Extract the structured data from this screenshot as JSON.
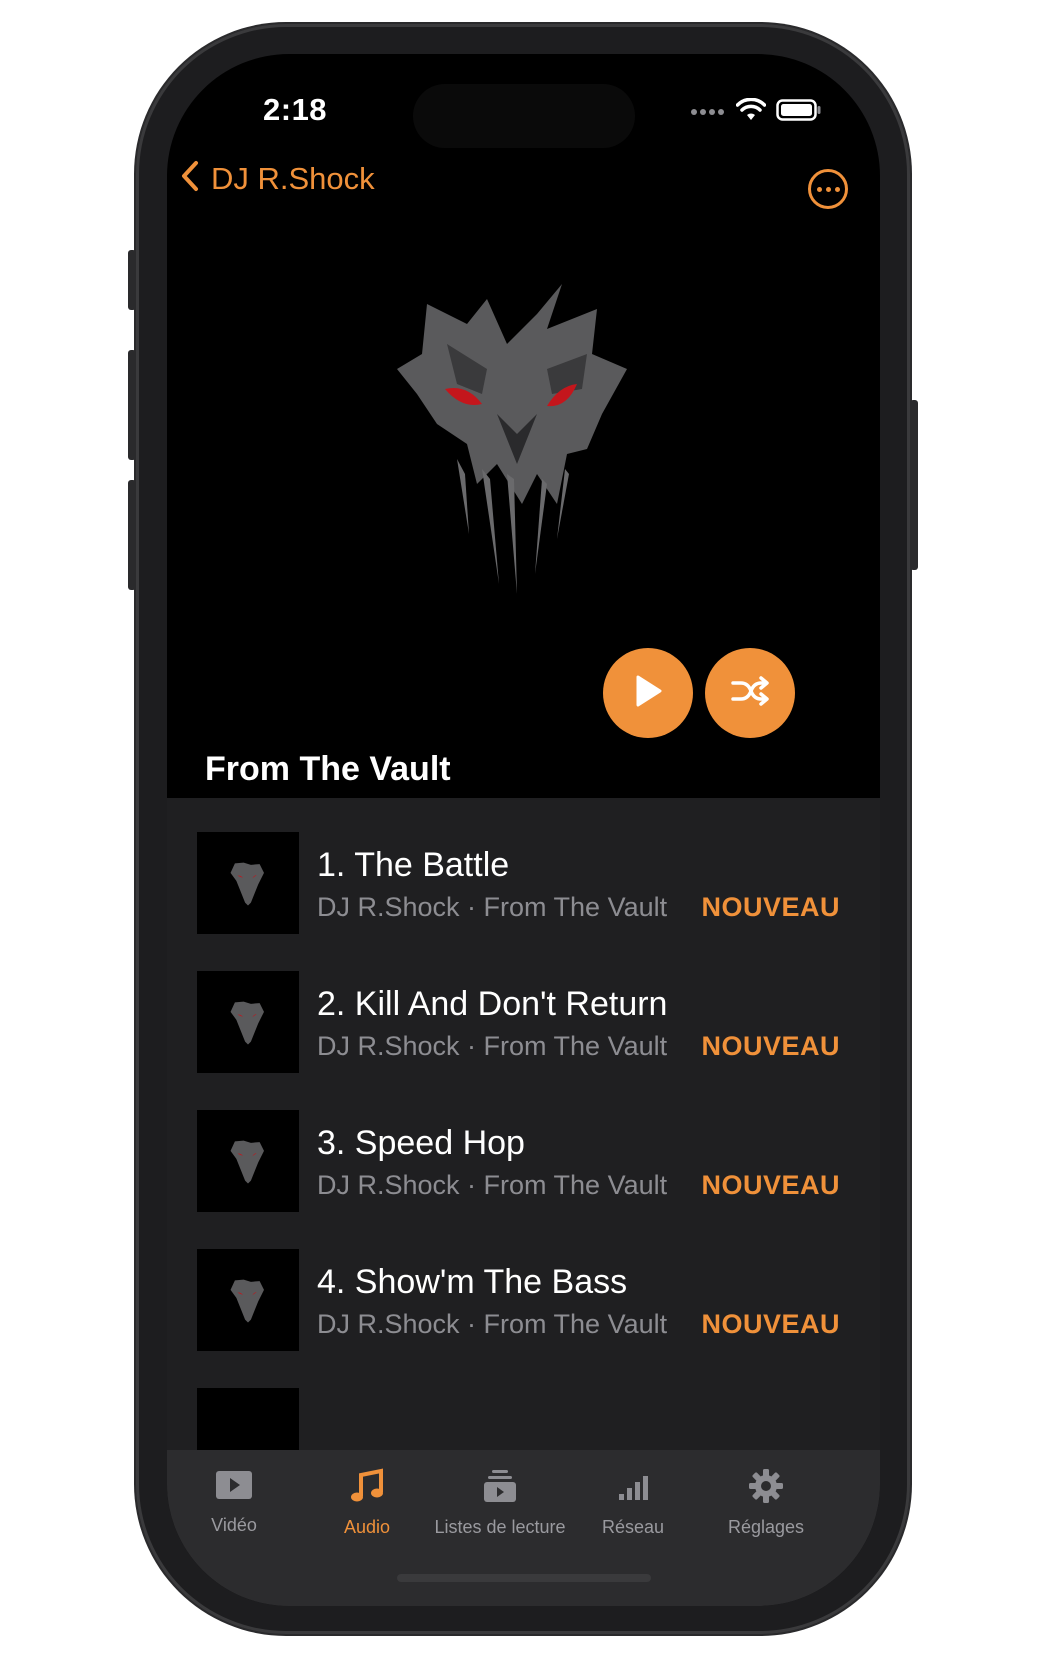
{
  "status": {
    "time": "2:18"
  },
  "nav": {
    "back_label": "DJ R.Shock"
  },
  "album": {
    "title": "From The Vault"
  },
  "tracks": [
    {
      "title": "1. The Battle",
      "subtitle": "DJ R.Shock · From The Vault",
      "badge": "NOUVEAU"
    },
    {
      "title": "2. Kill And Don't Return",
      "subtitle": "DJ R.Shock · From The Vault",
      "badge": "NOUVEAU"
    },
    {
      "title": "3. Speed Hop",
      "subtitle": "DJ R.Shock · From The Vault",
      "badge": "NOUVEAU"
    },
    {
      "title": "4. Show'm The Bass",
      "subtitle": "DJ R.Shock · From The Vault",
      "badge": "NOUVEAU"
    }
  ],
  "tabs": [
    {
      "label": "Vidéo",
      "icon": "video-icon"
    },
    {
      "label": "Audio",
      "icon": "music-note-icon"
    },
    {
      "label": "Listes de lecture",
      "icon": "playlist-icon"
    },
    {
      "label": "Réseau",
      "icon": "network-icon"
    },
    {
      "label": "Réglages",
      "icon": "gear-icon"
    }
  ],
  "colors": {
    "accent": "#f0913a",
    "background": "#000000",
    "list_background": "#1f1f21",
    "tabbar": "#2c2c2e"
  }
}
